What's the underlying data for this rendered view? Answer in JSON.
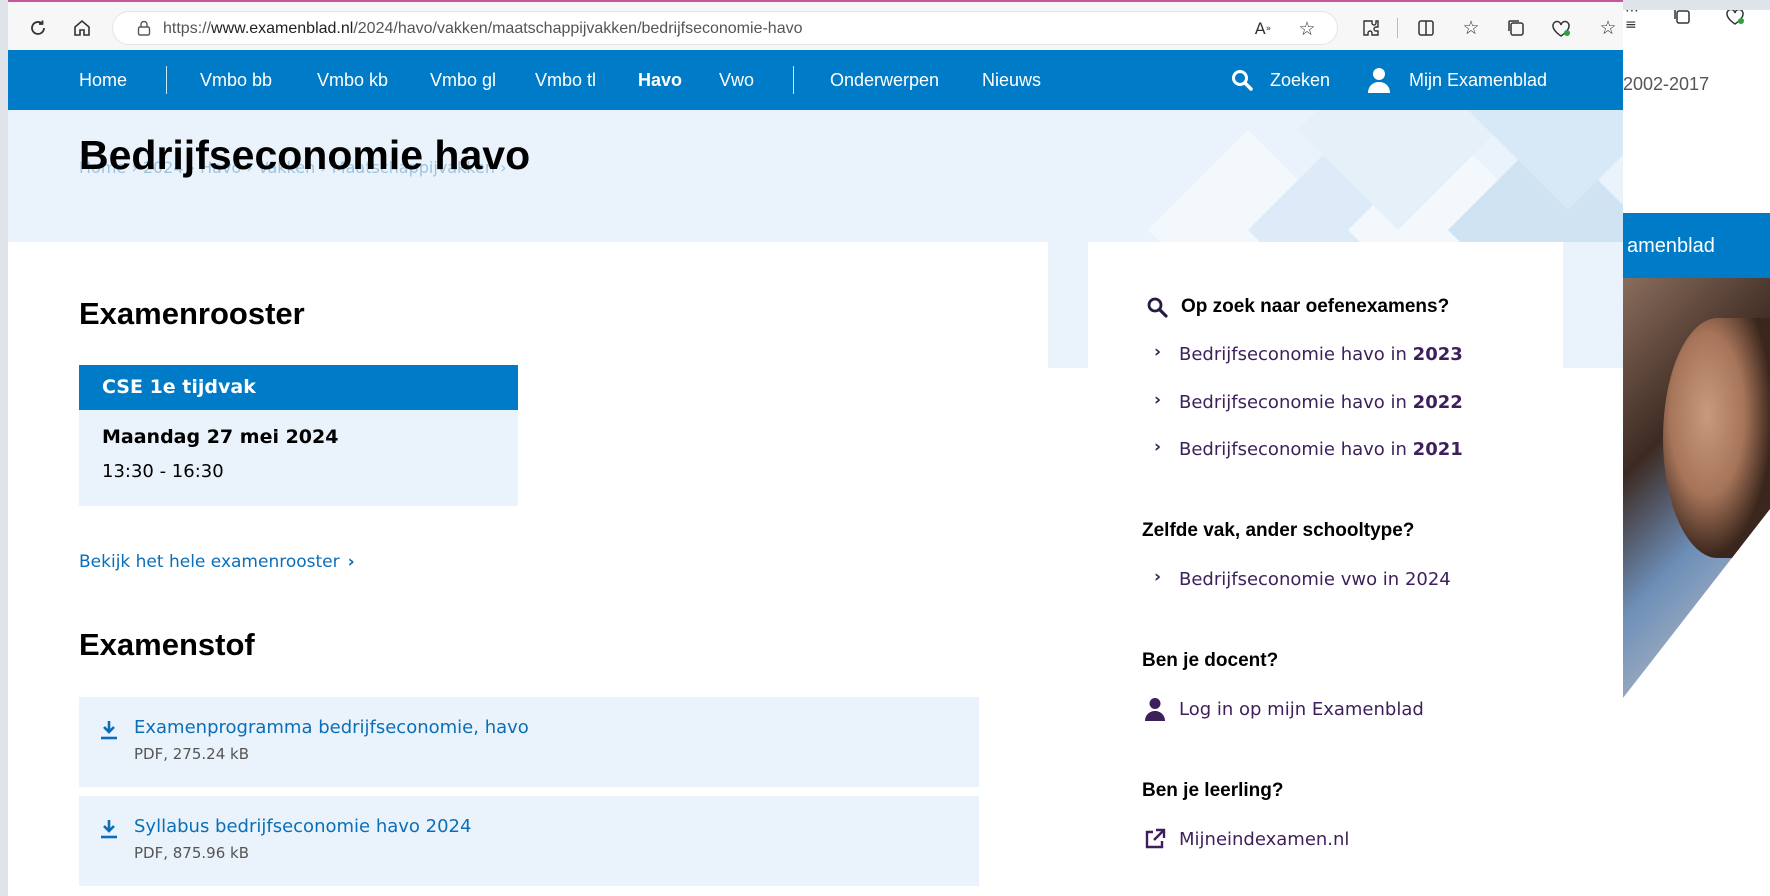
{
  "browser": {
    "url_prefix": "https://",
    "url_domain": "www.examenblad.nl",
    "url_path": "/2024/havo/vakken/maatschappijvakken/bedrijfseconomie-havo"
  },
  "background_peek": {
    "years": "2002-2017",
    "title": "amenblad"
  },
  "nav": {
    "items": [
      {
        "label": "Home"
      },
      {
        "label": "Vmbo bb"
      },
      {
        "label": "Vmbo kb"
      },
      {
        "label": "Vmbo gl"
      },
      {
        "label": "Vmbo tl"
      },
      {
        "label": "Havo"
      },
      {
        "label": "Vwo"
      },
      {
        "label": "Onderwerpen"
      },
      {
        "label": "Nieuws"
      }
    ],
    "search_label": "Zoeken",
    "account_label": "Mijn Examenblad"
  },
  "hero": {
    "breadcrumb": "Home  ›  2024  ›  Havo  ›  Vakken  ›  Maatschappijvakken  ›",
    "title": "Bedrijfseconomie havo"
  },
  "examenrooster": {
    "heading": "Examenrooster",
    "card_label": "CSE 1e tijdvak",
    "date": "Maandag 27 mei 2024",
    "time": "13:30 - 16:30",
    "link": "Bekijk het hele examenrooster"
  },
  "examenstof": {
    "heading": "Examenstof",
    "files": [
      {
        "title": "Examenprogramma bedrijfseconomie, havo",
        "meta": "PDF, 275.24 kB"
      },
      {
        "title": "Syllabus bedrijfseconomie havo 2024",
        "meta": "PDF, 875.96 kB"
      }
    ]
  },
  "sidebar": {
    "oefen_heading": "Op zoek naar oefenexamens?",
    "oefen_links": [
      {
        "text": "Bedrijfseconomie havo in ",
        "year": "2023"
      },
      {
        "text": "Bedrijfseconomie havo in ",
        "year": "2022"
      },
      {
        "text": "Bedrijfseconomie havo in ",
        "year": "2021"
      }
    ],
    "schooltype_heading": "Zelfde vak, ander schooltype?",
    "schooltype_link": "Bedrijfseconomie vwo in 2024",
    "docent_heading": "Ben je docent?",
    "docent_link": "Log in op mijn Examenblad",
    "leerling_heading": "Ben je leerling?",
    "leerling_link": "Mijneindexamen.nl"
  },
  "colors": {
    "brand_blue": "#007bc7",
    "link_blue": "#0a6fb8",
    "light_blue_bg": "#eaf3fb",
    "sidebar_link": "#3d1f5c"
  }
}
